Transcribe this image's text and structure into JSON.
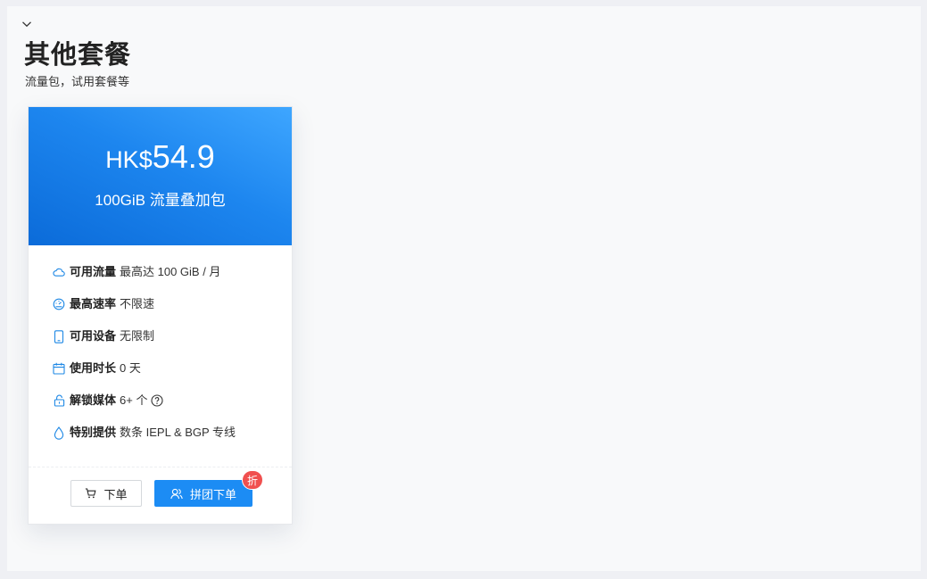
{
  "section": {
    "title": "其他套餐",
    "subtitle": "流量包，试用套餐等",
    "toggle_icon": "chevron-down-icon"
  },
  "card": {
    "header_gradient": [
      "#3ea6ff",
      "#0b6bd9"
    ],
    "price_currency": "HK$",
    "price_amount": "54.9",
    "plan_name": "100GiB 流量叠加包",
    "features": [
      {
        "icon": "cloud-icon",
        "label": "可用流量",
        "value": "最高达 100 GiB / 月"
      },
      {
        "icon": "speedometer-icon",
        "label": "最高速率",
        "value": "不限速"
      },
      {
        "icon": "phone-icon",
        "label": "可用设备",
        "value": "无限制"
      },
      {
        "icon": "calendar-icon",
        "label": "使用时长",
        "value": "0 天"
      },
      {
        "icon": "lock-icon",
        "label": "解锁媒体",
        "value": "6+ 个",
        "help_icon": "question-circle-icon"
      },
      {
        "icon": "drop-icon",
        "label": "特别提供",
        "value": "数条 IEPL & BGP 专线"
      }
    ],
    "order_button": {
      "label": "下单",
      "icon": "cart-icon"
    },
    "group_button": {
      "label": "拼团下单",
      "icon": "users-icon",
      "badge": "折"
    }
  },
  "colors": {
    "accent": "#1c8cf4",
    "icon": "#1e88e5",
    "badge": "#f0504f",
    "page_background": "#f8f9fa"
  }
}
